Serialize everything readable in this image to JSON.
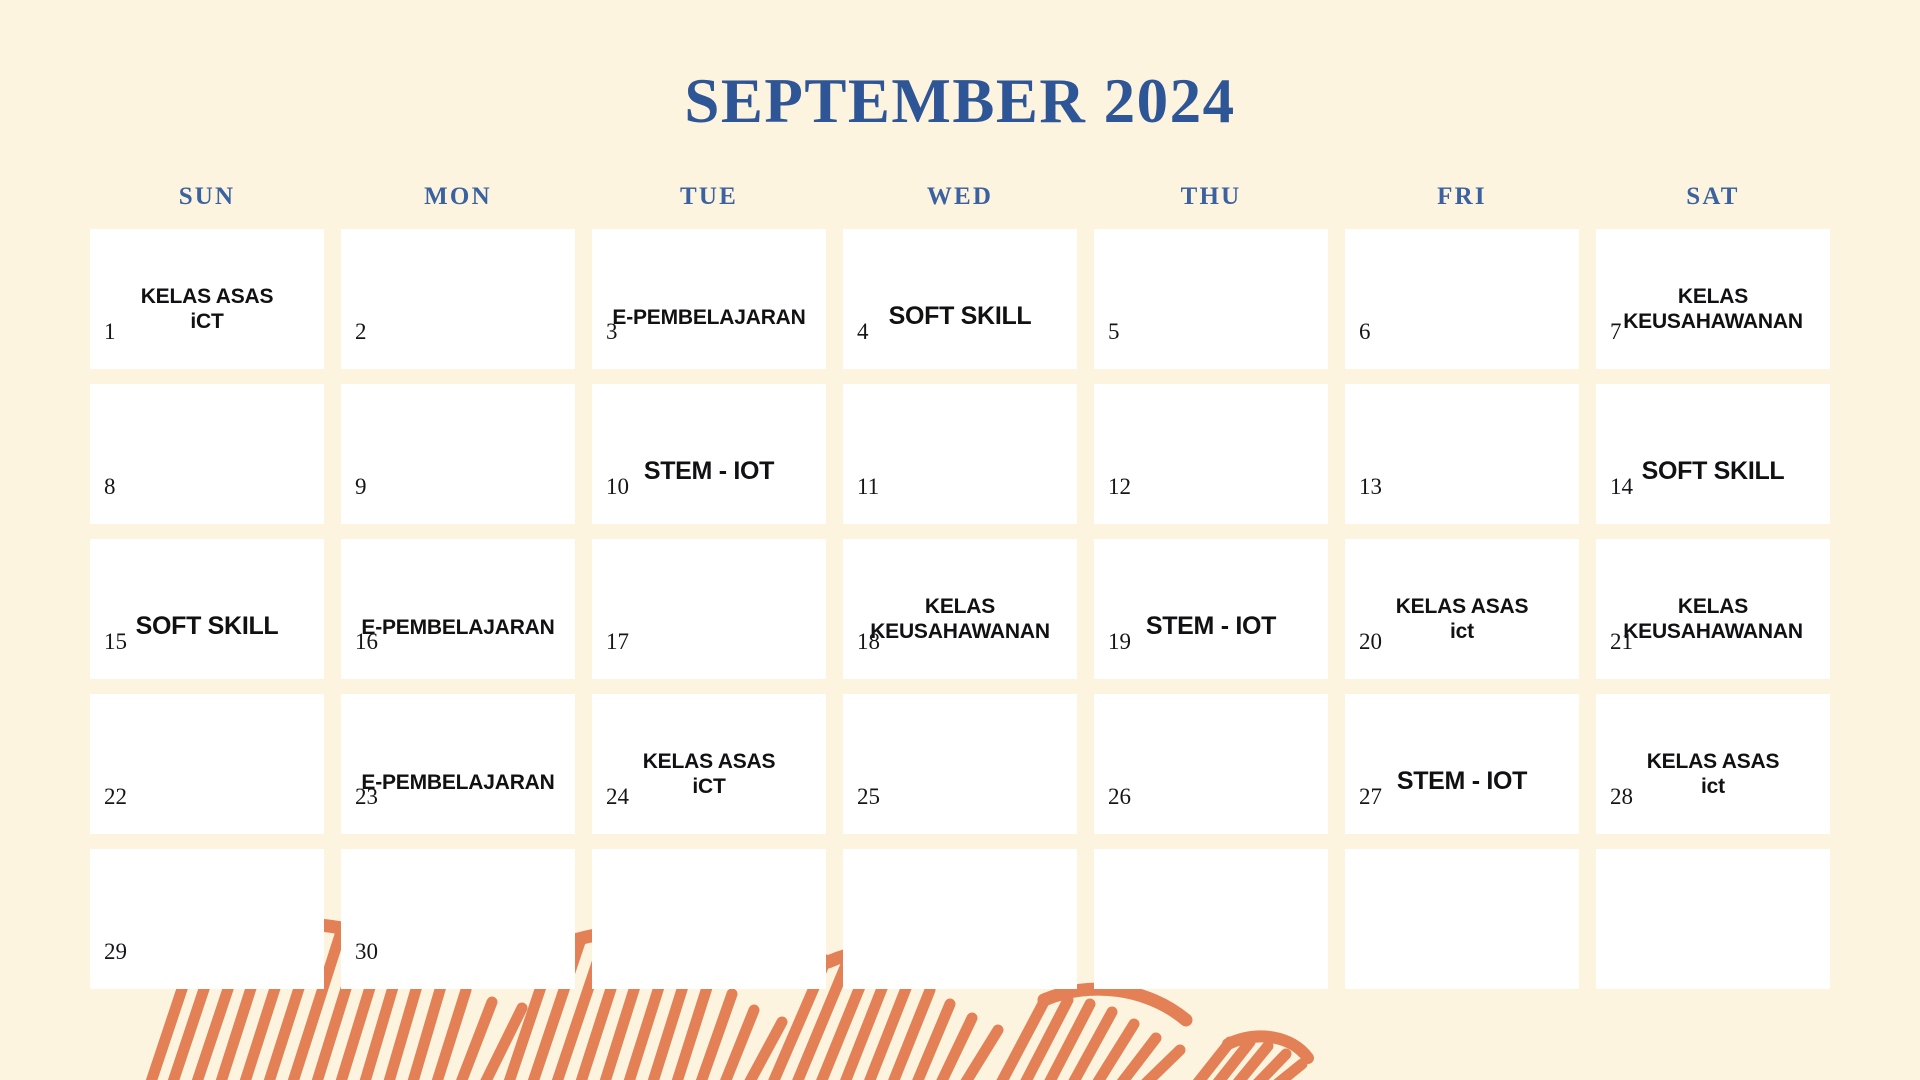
{
  "theme": {
    "background_color": "#FDF4E0",
    "cell_color": "#FFFFFF",
    "title_color": "#2E5596",
    "dow_color": "#3A61A0",
    "event_text_color": "#111114",
    "daynum_color": "#16161A",
    "scribble_color": "#E38055"
  },
  "header": {
    "title": "SEPTEMBER 2024"
  },
  "weekdays": [
    {
      "label": "SUN"
    },
    {
      "label": "MON"
    },
    {
      "label": "TUE"
    },
    {
      "label": "WED"
    },
    {
      "label": "THU"
    },
    {
      "label": "FRI"
    },
    {
      "label": "SAT"
    }
  ],
  "calendar": {
    "month": "SEPTEMBER",
    "year": "2024",
    "weeks": [
      [
        {
          "day": "1",
          "event": "KELAS ASAS\niCT",
          "style": "two-line"
        },
        {
          "day": "2",
          "event": "",
          "style": ""
        },
        {
          "day": "3",
          "event": "E-PEMBELAJARAN",
          "style": ""
        },
        {
          "day": "4",
          "event": "SOFT SKILL",
          "style": "big"
        },
        {
          "day": "5",
          "event": "",
          "style": ""
        },
        {
          "day": "6",
          "event": "",
          "style": ""
        },
        {
          "day": "7",
          "event": "KELAS\nKEUSAHAWANAN",
          "style": "two-line"
        }
      ],
      [
        {
          "day": "8",
          "event": "",
          "style": ""
        },
        {
          "day": "9",
          "event": "",
          "style": ""
        },
        {
          "day": "10",
          "event": "STEM - IOT",
          "style": "big"
        },
        {
          "day": "11",
          "event": "",
          "style": ""
        },
        {
          "day": "12",
          "event": "",
          "style": ""
        },
        {
          "day": "13",
          "event": "",
          "style": ""
        },
        {
          "day": "14",
          "event": "SOFT SKILL",
          "style": "big"
        }
      ],
      [
        {
          "day": "15",
          "event": "SOFT SKILL",
          "style": "big"
        },
        {
          "day": "16",
          "event": "E-PEMBELAJARAN",
          "style": ""
        },
        {
          "day": "17",
          "event": "",
          "style": ""
        },
        {
          "day": "18",
          "event": "KELAS\nKEUSAHAWANAN",
          "style": "two-line"
        },
        {
          "day": "19",
          "event": "STEM - IOT",
          "style": "big"
        },
        {
          "day": "20",
          "event": "KELAS ASAS\nict",
          "style": "two-line"
        },
        {
          "day": "21",
          "event": "KELAS\nKEUSAHAWANAN",
          "style": "two-line"
        }
      ],
      [
        {
          "day": "22",
          "event": "",
          "style": ""
        },
        {
          "day": "23",
          "event": "E-PEMBELAJARAN",
          "style": ""
        },
        {
          "day": "24",
          "event": "KELAS ASAS\niCT",
          "style": "two-line"
        },
        {
          "day": "25",
          "event": "",
          "style": ""
        },
        {
          "day": "26",
          "event": "",
          "style": ""
        },
        {
          "day": "27",
          "event": "STEM - IOT",
          "style": "big"
        },
        {
          "day": "28",
          "event": "KELAS ASAS\nict",
          "style": "two-line"
        }
      ],
      [
        {
          "day": "29",
          "event": "",
          "style": ""
        },
        {
          "day": "30",
          "event": "",
          "style": ""
        },
        {
          "day": "",
          "event": "",
          "style": ""
        },
        {
          "day": "",
          "event": "",
          "style": ""
        },
        {
          "day": "",
          "event": "",
          "style": ""
        },
        {
          "day": "",
          "event": "",
          "style": ""
        },
        {
          "day": "",
          "event": "",
          "style": ""
        }
      ]
    ]
  },
  "decoration": {
    "name": "orange-scribble-underline",
    "color": "#E38055"
  }
}
